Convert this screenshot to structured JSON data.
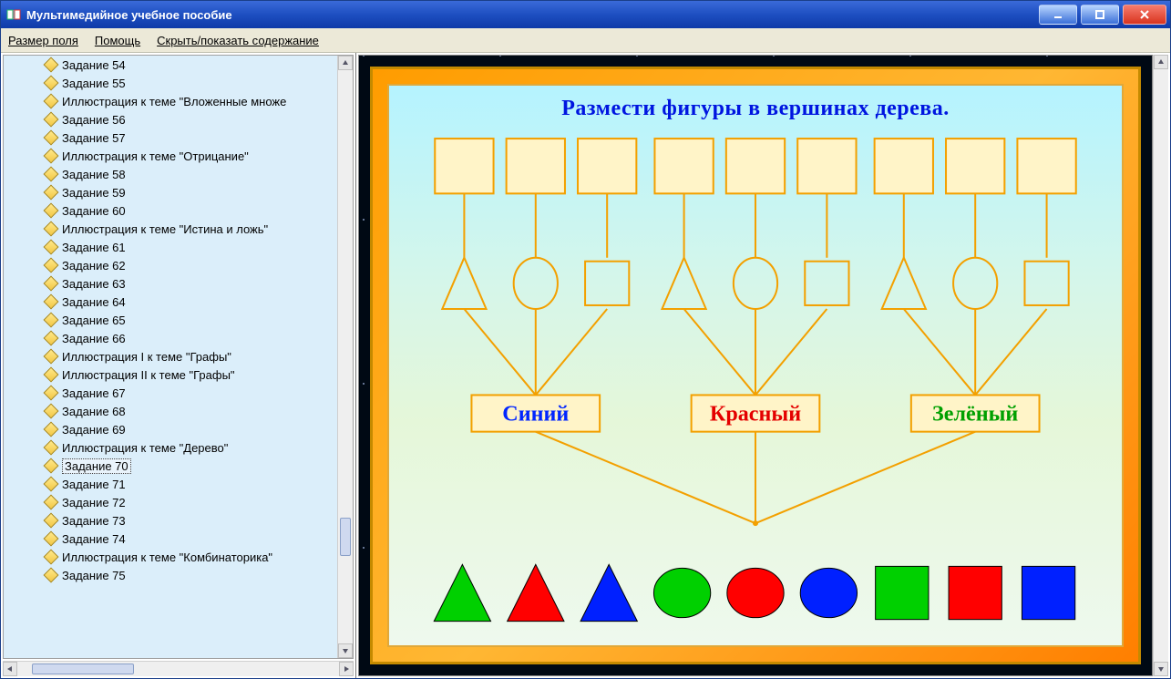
{
  "window": {
    "title": "Мультимедийное учебное пособие"
  },
  "menu": {
    "field_size": "Размер поля",
    "help": "Помощь",
    "toggle_toc": "Скрыть/показать содержание"
  },
  "tree": {
    "selected_index": 22,
    "items": [
      "Задание 54",
      "Задание 55",
      "Иллюстрация к теме \"Вложенные множе",
      "Задание 56",
      "Задание 57",
      "Иллюстрация к теме \"Отрицание\"",
      "Задание 58",
      "Задание 59",
      "Задание 60",
      "Иллюстрация к теме \"Истина и ложь\"",
      "Задание 61",
      "Задание 62",
      "Задание 63",
      "Задание 64",
      "Задание 65",
      "Задание 66",
      "Иллюстрация I к теме \"Графы\"",
      "Иллюстрация II к теме \"Графы\"",
      "Задание 67",
      "Задание 68",
      "Задание 69",
      "Иллюстрация к теме \"Дерево\"",
      "Задание 70",
      "Задание 71",
      "Задание 72",
      "Задание 73",
      "Задание 74",
      "Иллюстрация к теме \"Комбинаторика\"",
      "Задание 75"
    ]
  },
  "task": {
    "title": "Размести фигуры в вершинах дерева.",
    "colors": {
      "label_blue": {
        "text": "Синий",
        "text_color": "#0025ff"
      },
      "label_red": {
        "text": "Красный",
        "text_color": "#e40000"
      },
      "label_green": {
        "text": "Зелёный",
        "text_color": "#00a000"
      }
    },
    "palette_shapes": [
      {
        "shape": "triangle",
        "fill": "#00d000"
      },
      {
        "shape": "triangle",
        "fill": "#ff0000"
      },
      {
        "shape": "triangle",
        "fill": "#0020ff"
      },
      {
        "shape": "circle",
        "fill": "#00d000"
      },
      {
        "shape": "circle",
        "fill": "#ff0000"
      },
      {
        "shape": "circle",
        "fill": "#0020ff"
      },
      {
        "shape": "square",
        "fill": "#00d000"
      },
      {
        "shape": "square",
        "fill": "#ff0000"
      },
      {
        "shape": "square",
        "fill": "#0020ff"
      }
    ],
    "tree_structure": {
      "leaf_slots_per_group": 3,
      "mid_shapes": [
        "triangle",
        "circle",
        "square"
      ],
      "groups": [
        "blue",
        "red",
        "green"
      ]
    },
    "style": {
      "outline": "#f3a000",
      "slot_fill": "#fff4c8"
    }
  }
}
